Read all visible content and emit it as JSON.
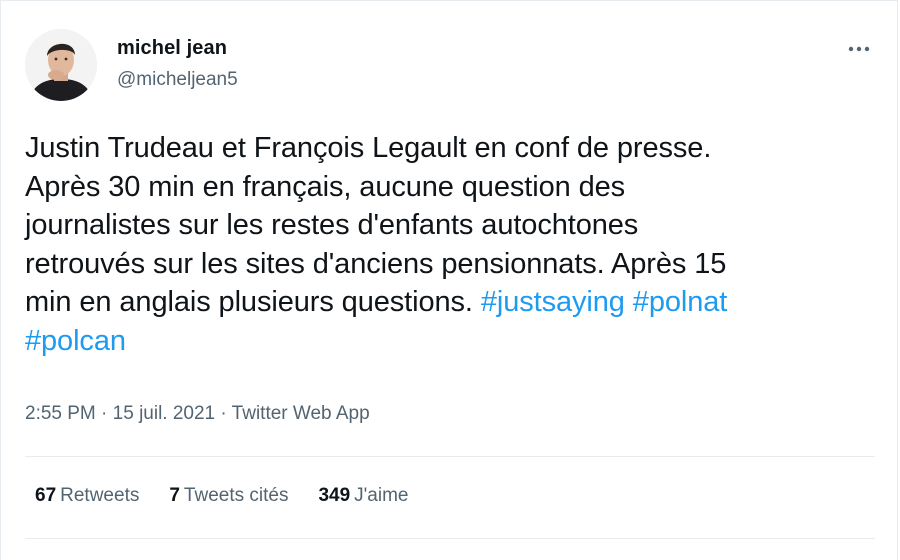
{
  "user": {
    "name": "michel jean",
    "handle": "@micheljean5"
  },
  "tweet": {
    "text": "Justin Trudeau et François Legault en conf de presse.\nAprès 30 min en français, aucune question des\njournalistes sur les restes d'enfants autochtones\nretrouvés sur les sites d'anciens pensionnats. Après 15\nmin en anglais plusieurs questions. ",
    "hashtags": [
      "#justsaying",
      "#polnat",
      "#polcan"
    ]
  },
  "meta": {
    "time": "2:55 PM",
    "sep1": " · ",
    "date": "15 juil. 2021",
    "sep2": " · ",
    "source": "Twitter Web App"
  },
  "stats": {
    "retweets_count": "67",
    "retweets_label": "Retweets",
    "quotes_count": "7",
    "quotes_label": "Tweets cités",
    "likes_count": "349",
    "likes_label": "J'aime"
  },
  "colors": {
    "link": "#1d9bf0",
    "secondary_text": "#536471",
    "primary_text": "#0f1419",
    "border": "#e6ecf0"
  },
  "icons": {
    "more": "more-horizontal-icon"
  }
}
